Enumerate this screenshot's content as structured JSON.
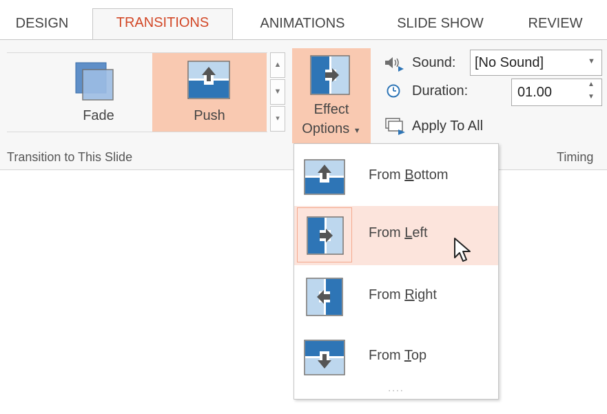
{
  "tabs": [
    {
      "label": "DESIGN",
      "active": false
    },
    {
      "label": "TRANSITIONS",
      "active": true
    },
    {
      "label": "ANIMATIONS",
      "active": false
    },
    {
      "label": "SLIDE SHOW",
      "active": false
    },
    {
      "label": "REVIEW",
      "active": false
    }
  ],
  "gallery": {
    "items": [
      {
        "label": "Fade",
        "icon": "fade-transition-icon",
        "selected": false
      },
      {
        "label": "Push",
        "icon": "push-transition-icon",
        "selected": true
      }
    ],
    "group_label": "Transition to This Slide"
  },
  "effect_options": {
    "line1": "Effect",
    "line2": "Options",
    "icon": "push-from-left-icon"
  },
  "timing": {
    "sound_label": "Sound:",
    "sound_value": "[No Sound]",
    "duration_label": "Duration:",
    "duration_value": "01.00",
    "apply_all_label": "Apply To All",
    "group_label": "Timing"
  },
  "dropdown": {
    "items": [
      {
        "label_pre": "From ",
        "label_key": "B",
        "label_post": "ottom",
        "icon": "push-from-bottom-icon",
        "hover": false
      },
      {
        "label_pre": "From ",
        "label_key": "L",
        "label_post": "eft",
        "icon": "push-from-left-icon",
        "hover": true
      },
      {
        "label_pre": "From ",
        "label_key": "R",
        "label_post": "ight",
        "icon": "push-from-right-icon",
        "hover": false
      },
      {
        "label_pre": "From ",
        "label_key": "T",
        "label_post": "op",
        "icon": "push-from-top-icon",
        "hover": false
      }
    ],
    "resize_grip": "...."
  },
  "colors": {
    "accent": "#d24726",
    "selected_fill": "#f9c9b1",
    "hover_fill": "#fce4dc",
    "icon_dark": "#2e75b6",
    "icon_light": "#bdd7ee"
  }
}
